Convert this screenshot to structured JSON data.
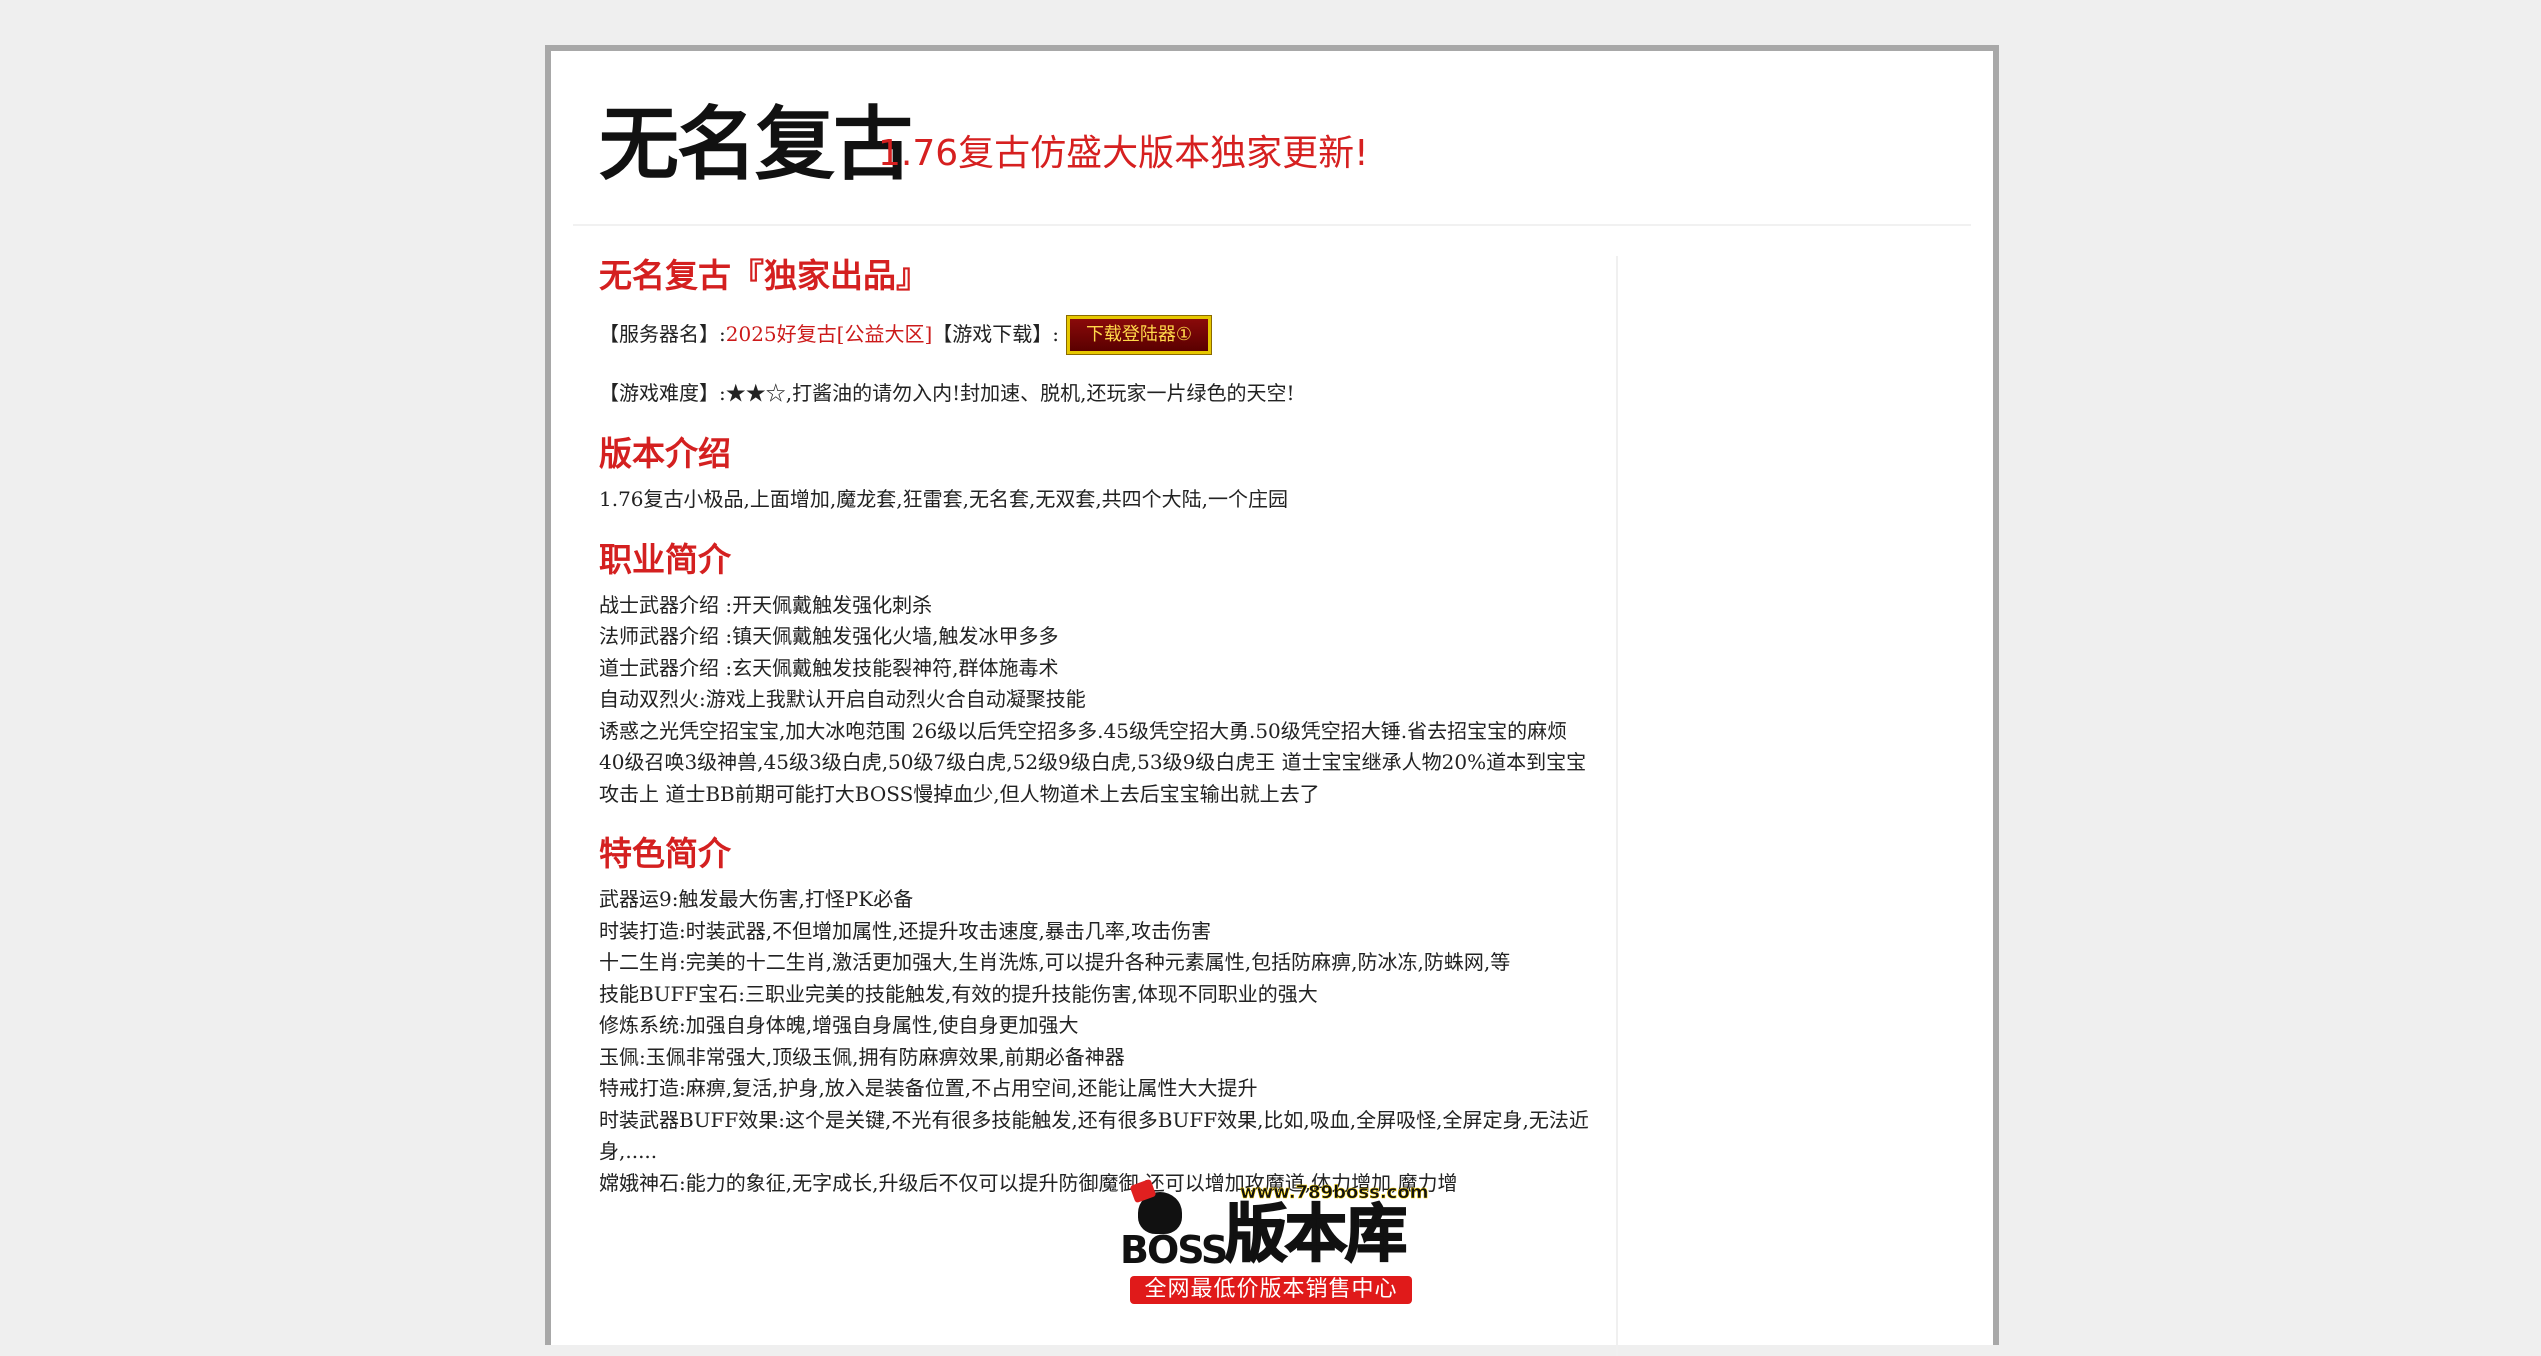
{
  "header": {
    "title": "无名复古",
    "subtitle": "1.76复古仿盛大版本独家更新!"
  },
  "article": {
    "heading": "无名复古『独家出品』",
    "server_label": "【服务器名】:",
    "server_name": "2025好复古[公益大区]",
    "download_label": "【游戏下载】:",
    "download_button": "下载登陆器①",
    "difficulty": "【游戏难度】:★★☆,打酱油的请勿入内!封加速、脱机,还玩家一片绿色的天空!",
    "sections": [
      {
        "title": "版本介绍",
        "lines": [
          "1.76复古小极品,上面增加,魔龙套,狂雷套,无名套,无双套,共四个大陆,一个庄园"
        ]
      },
      {
        "title": "职业简介",
        "lines": [
          "战士武器介绍 :开天佩戴触发强化刺杀",
          "法师武器介绍 :镇天佩戴触发强化火墙,触发冰甲多多",
          "道士武器介绍 :玄天佩戴触发技能裂神符,群体施毒术",
          "自动双烈火:游戏上我默认开启自动烈火合自动凝聚技能",
          "诱惑之光凭空招宝宝,加大冰咆范围 26级以后凭空招多多.45级凭空招大勇.50级凭空招大锤.省去招宝宝的麻烦",
          "40级召唤3级神兽,45级3级白虎,50级7级白虎,52级9级白虎,53级9级白虎王 道士宝宝继承人物20%道本到宝宝攻击上 道士BB前期可能打大BOSS慢掉血少,但人物道术上去后宝宝输出就上去了"
        ]
      },
      {
        "title": "特色简介",
        "lines": [
          "武器运9:触发最大伤害,打怪PK必备",
          "时装打造:时装武器,不但增加属性,还提升攻击速度,暴击几率,攻击伤害",
          "十二生肖:完美的十二生肖,激活更加强大,生肖洗炼,可以提升各种元素属性,包括防麻痹,防冰冻,防蛛网,等",
          "技能BUFF宝石:三职业完美的技能触发,有效的提升技能伤害,体现不同职业的强大",
          "修炼系统:加强自身体魄,增强自身属性,使自身更加强大",
          "玉佩:玉佩非常强大,顶级玉佩,拥有防麻痹效果,前期必备神器",
          "特戒打造:麻痹,复活,护身,放入是装备位置,不占用空间,还能让属性大大提升",
          "时装武器BUFF效果:这个是关键,不光有很多技能触发,还有很多BUFF效果,比如,吸血,全屏吸怪,全屏定身,无法近身,.....",
          "嫦娥神石:能力的象征,无字成长,升级后不仅可以提升防御魔御,还可以增加攻魔道,体力增加,魔力增"
        ]
      }
    ]
  },
  "watermark": {
    "url": "www.789boss.com",
    "brand": "BOSS",
    "name": "版本库",
    "tagline": "全网最低价版本销售中心"
  }
}
